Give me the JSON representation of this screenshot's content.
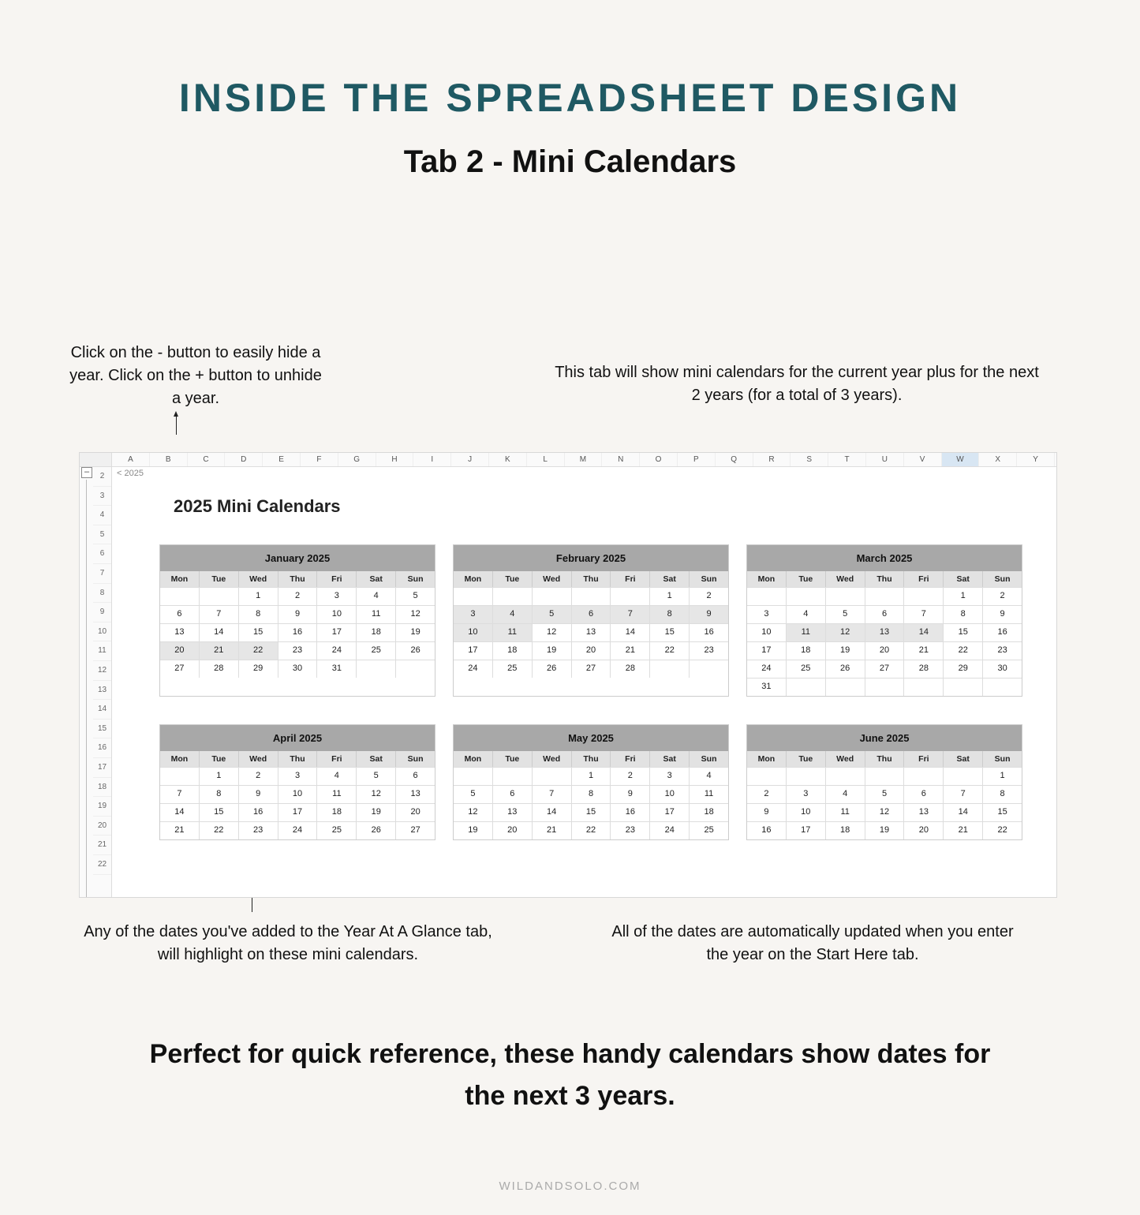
{
  "main_title": "INSIDE THE SPREADSHEET DESIGN",
  "sub_title": "Tab 2 - Mini Calendars",
  "callouts": {
    "top_left": "Click on the - button to easily hide a year. Click on the + button to unhide a year.",
    "top_right": "This tab will show mini calendars for the current year plus for the next 2 years (for a total of 3 years).",
    "bottom_left": "Any of the dates you've added to the Year At A Glance tab, will highlight on these mini calendars.",
    "bottom_right": "All of the dates are automatically updated when you enter the year on the Start Here tab."
  },
  "sheet": {
    "year_label": "< 2025",
    "title": "2025 Mini Calendars",
    "collapse_symbol": "–",
    "col_letters": [
      "A",
      "B",
      "C",
      "D",
      "E",
      "F",
      "G",
      "H",
      "I",
      "J",
      "K",
      "L",
      "M",
      "N",
      "O",
      "P",
      "Q",
      "R",
      "S",
      "T",
      "U",
      "V",
      "W",
      "X",
      "Y"
    ],
    "selected_col_index": 22,
    "row_numbers": [
      "2",
      "3",
      "4",
      "5",
      "6",
      "7",
      "8",
      "9",
      "10",
      "11",
      "12",
      "13",
      "14",
      "15",
      "16",
      "17",
      "18",
      "19",
      "20",
      "21",
      "22"
    ],
    "day_headers": [
      "Mon",
      "Tue",
      "Wed",
      "Thu",
      "Fri",
      "Sat",
      "Sun"
    ],
    "months_row1": [
      {
        "title": "January 2025",
        "weeks": [
          [
            {
              "d": ""
            },
            {
              "d": ""
            },
            {
              "d": "1"
            },
            {
              "d": "2"
            },
            {
              "d": "3"
            },
            {
              "d": "4"
            },
            {
              "d": "5"
            }
          ],
          [
            {
              "d": "6"
            },
            {
              "d": "7"
            },
            {
              "d": "8"
            },
            {
              "d": "9"
            },
            {
              "d": "10"
            },
            {
              "d": "11"
            },
            {
              "d": "12"
            }
          ],
          [
            {
              "d": "13"
            },
            {
              "d": "14"
            },
            {
              "d": "15"
            },
            {
              "d": "16"
            },
            {
              "d": "17"
            },
            {
              "d": "18"
            },
            {
              "d": "19"
            }
          ],
          [
            {
              "d": "20",
              "hl": true
            },
            {
              "d": "21",
              "hl": true
            },
            {
              "d": "22",
              "hl": true
            },
            {
              "d": "23"
            },
            {
              "d": "24"
            },
            {
              "d": "25"
            },
            {
              "d": "26"
            }
          ],
          [
            {
              "d": "27"
            },
            {
              "d": "28"
            },
            {
              "d": "29"
            },
            {
              "d": "30"
            },
            {
              "d": "31"
            },
            {
              "d": ""
            },
            {
              "d": ""
            }
          ]
        ]
      },
      {
        "title": "February 2025",
        "weeks": [
          [
            {
              "d": ""
            },
            {
              "d": ""
            },
            {
              "d": ""
            },
            {
              "d": ""
            },
            {
              "d": ""
            },
            {
              "d": "1"
            },
            {
              "d": "2"
            }
          ],
          [
            {
              "d": "3",
              "hl": true
            },
            {
              "d": "4",
              "hl": true
            },
            {
              "d": "5",
              "hl": true
            },
            {
              "d": "6",
              "hl": true
            },
            {
              "d": "7",
              "hl": true
            },
            {
              "d": "8",
              "hl": true
            },
            {
              "d": "9",
              "hl": true
            }
          ],
          [
            {
              "d": "10",
              "hl": true
            },
            {
              "d": "11",
              "hl": true
            },
            {
              "d": "12"
            },
            {
              "d": "13"
            },
            {
              "d": "14"
            },
            {
              "d": "15"
            },
            {
              "d": "16"
            }
          ],
          [
            {
              "d": "17"
            },
            {
              "d": "18"
            },
            {
              "d": "19"
            },
            {
              "d": "20"
            },
            {
              "d": "21"
            },
            {
              "d": "22"
            },
            {
              "d": "23"
            }
          ],
          [
            {
              "d": "24"
            },
            {
              "d": "25"
            },
            {
              "d": "26"
            },
            {
              "d": "27"
            },
            {
              "d": "28"
            },
            {
              "d": ""
            },
            {
              "d": ""
            }
          ]
        ]
      },
      {
        "title": "March 2025",
        "weeks": [
          [
            {
              "d": ""
            },
            {
              "d": ""
            },
            {
              "d": ""
            },
            {
              "d": ""
            },
            {
              "d": ""
            },
            {
              "d": "1"
            },
            {
              "d": "2"
            }
          ],
          [
            {
              "d": "3"
            },
            {
              "d": "4"
            },
            {
              "d": "5"
            },
            {
              "d": "6"
            },
            {
              "d": "7"
            },
            {
              "d": "8"
            },
            {
              "d": "9"
            }
          ],
          [
            {
              "d": "10"
            },
            {
              "d": "11",
              "hl": true
            },
            {
              "d": "12",
              "hl": true
            },
            {
              "d": "13",
              "hl": true
            },
            {
              "d": "14",
              "hl": true
            },
            {
              "d": "15"
            },
            {
              "d": "16"
            }
          ],
          [
            {
              "d": "17"
            },
            {
              "d": "18"
            },
            {
              "d": "19"
            },
            {
              "d": "20"
            },
            {
              "d": "21"
            },
            {
              "d": "22"
            },
            {
              "d": "23"
            }
          ],
          [
            {
              "d": "24"
            },
            {
              "d": "25"
            },
            {
              "d": "26"
            },
            {
              "d": "27"
            },
            {
              "d": "28"
            },
            {
              "d": "29"
            },
            {
              "d": "30"
            }
          ],
          [
            {
              "d": "31"
            },
            {
              "d": ""
            },
            {
              "d": ""
            },
            {
              "d": ""
            },
            {
              "d": ""
            },
            {
              "d": ""
            },
            {
              "d": ""
            }
          ]
        ]
      }
    ],
    "months_row2": [
      {
        "title": "April 2025",
        "weeks": [
          [
            {
              "d": ""
            },
            {
              "d": "1"
            },
            {
              "d": "2"
            },
            {
              "d": "3"
            },
            {
              "d": "4"
            },
            {
              "d": "5"
            },
            {
              "d": "6"
            }
          ],
          [
            {
              "d": "7"
            },
            {
              "d": "8"
            },
            {
              "d": "9"
            },
            {
              "d": "10"
            },
            {
              "d": "11"
            },
            {
              "d": "12"
            },
            {
              "d": "13"
            }
          ],
          [
            {
              "d": "14"
            },
            {
              "d": "15"
            },
            {
              "d": "16"
            },
            {
              "d": "17"
            },
            {
              "d": "18"
            },
            {
              "d": "19"
            },
            {
              "d": "20"
            }
          ],
          [
            {
              "d": "21"
            },
            {
              "d": "22"
            },
            {
              "d": "23"
            },
            {
              "d": "24"
            },
            {
              "d": "25"
            },
            {
              "d": "26"
            },
            {
              "d": "27"
            }
          ]
        ]
      },
      {
        "title": "May 2025",
        "weeks": [
          [
            {
              "d": ""
            },
            {
              "d": ""
            },
            {
              "d": ""
            },
            {
              "d": "1"
            },
            {
              "d": "2"
            },
            {
              "d": "3"
            },
            {
              "d": "4"
            }
          ],
          [
            {
              "d": "5"
            },
            {
              "d": "6"
            },
            {
              "d": "7"
            },
            {
              "d": "8"
            },
            {
              "d": "9"
            },
            {
              "d": "10"
            },
            {
              "d": "11"
            }
          ],
          [
            {
              "d": "12"
            },
            {
              "d": "13"
            },
            {
              "d": "14"
            },
            {
              "d": "15"
            },
            {
              "d": "16"
            },
            {
              "d": "17"
            },
            {
              "d": "18"
            }
          ],
          [
            {
              "d": "19"
            },
            {
              "d": "20"
            },
            {
              "d": "21"
            },
            {
              "d": "22"
            },
            {
              "d": "23"
            },
            {
              "d": "24"
            },
            {
              "d": "25"
            }
          ]
        ]
      },
      {
        "title": "June 2025",
        "weeks": [
          [
            {
              "d": ""
            },
            {
              "d": ""
            },
            {
              "d": ""
            },
            {
              "d": ""
            },
            {
              "d": ""
            },
            {
              "d": ""
            },
            {
              "d": "1"
            }
          ],
          [
            {
              "d": "2"
            },
            {
              "d": "3"
            },
            {
              "d": "4"
            },
            {
              "d": "5"
            },
            {
              "d": "6"
            },
            {
              "d": "7"
            },
            {
              "d": "8"
            }
          ],
          [
            {
              "d": "9"
            },
            {
              "d": "10"
            },
            {
              "d": "11"
            },
            {
              "d": "12"
            },
            {
              "d": "13"
            },
            {
              "d": "14"
            },
            {
              "d": "15"
            }
          ],
          [
            {
              "d": "16"
            },
            {
              "d": "17"
            },
            {
              "d": "18"
            },
            {
              "d": "19"
            },
            {
              "d": "20"
            },
            {
              "d": "21"
            },
            {
              "d": "22"
            }
          ]
        ]
      }
    ]
  },
  "closing": "Perfect for quick reference, these handy calendars show dates for the next 3 years.",
  "footer": "WILDANDSOLO.COM"
}
